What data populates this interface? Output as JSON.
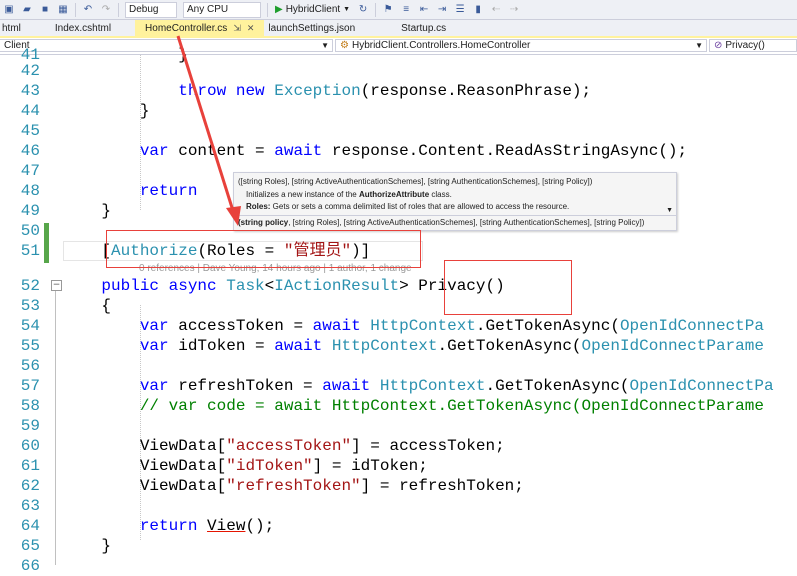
{
  "toolbar": {
    "config": "Debug",
    "platform": "Any CPU",
    "run_target": "HybridClient",
    "run_icon": "play-icon"
  },
  "tabs": [
    {
      "label": "html",
      "active": false
    },
    {
      "label": "Index.cshtml",
      "active": false
    },
    {
      "label": "HomeController.cs",
      "active": true
    },
    {
      "label": "launchSettings.json",
      "active": false
    },
    {
      "label": "Startup.cs",
      "active": false
    }
  ],
  "navbar": {
    "project": "Client",
    "class": "HybridClient.Controllers.HomeController",
    "member": "Privacy()"
  },
  "editor": {
    "lines": [
      {
        "n": "41",
        "text": "            }"
      },
      {
        "n": "42",
        "text": ""
      },
      {
        "n": "43",
        "text": "            throw new Exception(response.ReasonPhrase);"
      },
      {
        "n": "44",
        "text": "        }"
      },
      {
        "n": "45",
        "text": ""
      },
      {
        "n": "46",
        "text": "        var content = await response.Content.ReadAsStringAsync();"
      },
      {
        "n": "47",
        "text": ""
      },
      {
        "n": "48",
        "text": "        return"
      },
      {
        "n": "49",
        "text": "    }"
      },
      {
        "n": "50",
        "text": ""
      },
      {
        "n": "51",
        "text": "    [Authorize(Roles = \"管理员\")]"
      },
      {
        "n": "52",
        "text": "    public async Task<IActionResult> Privacy()"
      },
      {
        "n": "53",
        "text": "    {"
      },
      {
        "n": "54",
        "text": "        var accessToken = await HttpContext.GetTokenAsync(OpenIdConnectPa"
      },
      {
        "n": "55",
        "text": "        var idToken = await HttpContext.GetTokenAsync(OpenIdConnectParame"
      },
      {
        "n": "56",
        "text": ""
      },
      {
        "n": "57",
        "text": "        var refreshToken = await HttpContext.GetTokenAsync(OpenIdConnectPa"
      },
      {
        "n": "58",
        "text": "        // var code = await HttpContext.GetTokenAsync(OpenIdConnectParame"
      },
      {
        "n": "59",
        "text": ""
      },
      {
        "n": "60",
        "text": "        ViewData[\"accessToken\"] = accessToken;"
      },
      {
        "n": "61",
        "text": "        ViewData[\"idToken\"] = idToken;"
      },
      {
        "n": "62",
        "text": "        ViewData[\"refreshToken\"] = refreshToken;"
      },
      {
        "n": "63",
        "text": ""
      },
      {
        "n": "64",
        "text": "        return View();"
      },
      {
        "n": "65",
        "text": "    }"
      },
      {
        "n": "66",
        "text": ""
      }
    ],
    "codelens": "0 references | Dave Young, 14 hours ago | 1 author, 1 change"
  },
  "tooltip": {
    "signature": "([string Roles], [string ActiveAuthenticationSchemes], [string AuthenticationSchemes], [string Policy])",
    "summary_prefix": "Initializes a new instance of the ",
    "summary_class": "AuthorizeAttribute",
    "summary_suffix": " class.",
    "param_name": "Roles:",
    "param_desc": " Gets or sets a comma delimited list of roles that are allowed to access the resource.",
    "overload_bold": "(string policy",
    "overload_rest": ", [string Roles], [string ActiveAuthenticationSchemes], [string AuthenticationSchemes], [string Policy])"
  },
  "colors": {
    "keyword": "#0000ff",
    "type": "#2b91af",
    "string": "#a31515",
    "comment": "#008000",
    "annotation": "#e8413b",
    "active_tab": "#fff29d"
  }
}
